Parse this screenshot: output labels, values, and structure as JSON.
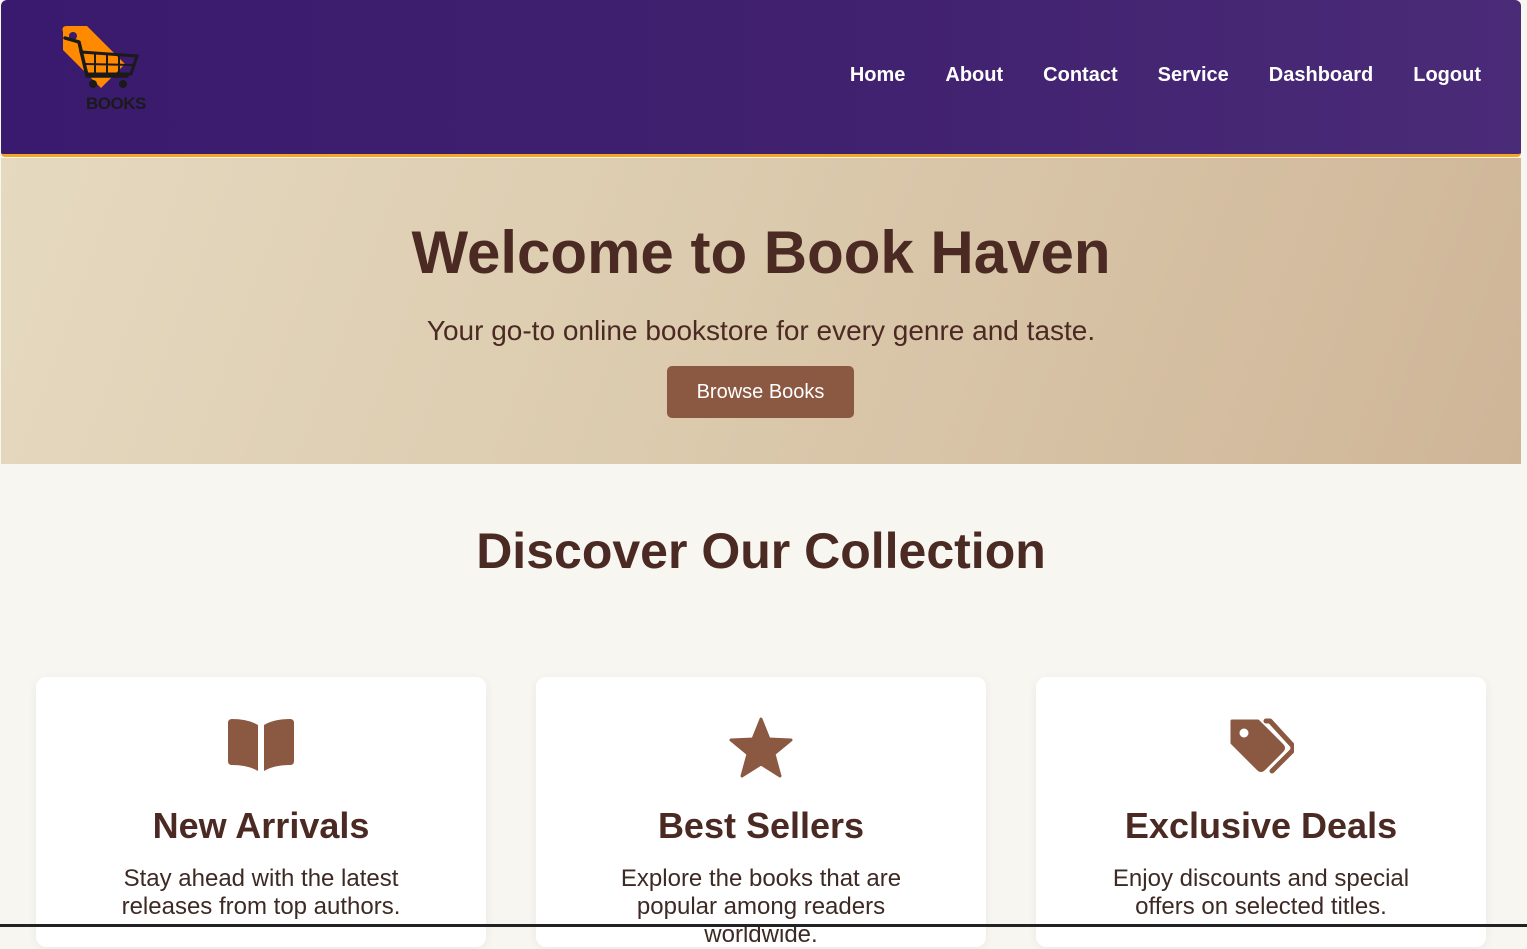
{
  "header": {
    "logo_text": "BOOKS",
    "nav": [
      {
        "label": "Home"
      },
      {
        "label": "About"
      },
      {
        "label": "Contact"
      },
      {
        "label": "Service"
      },
      {
        "label": "Dashboard"
      },
      {
        "label": "Logout"
      }
    ],
    "colors": {
      "background": "#3a1a6e",
      "accent_border": "#f5a623",
      "logo_tag": "#ff8a00"
    }
  },
  "hero": {
    "title": "Welcome to Book Haven",
    "subtitle": "Your go-to online bookstore for every genre and taste.",
    "button_label": "Browse Books",
    "colors": {
      "text": "#4a2a22",
      "button": "#8b5842"
    }
  },
  "collection": {
    "title": "Discover Our Collection",
    "cards": [
      {
        "icon": "book-open-icon",
        "title": "New Arrivals",
        "text": "Stay ahead with the latest releases from top authors."
      },
      {
        "icon": "star-icon",
        "title": "Best Sellers",
        "text": "Explore the books that are popular among readers worldwide."
      },
      {
        "icon": "tags-icon",
        "title": "Exclusive Deals",
        "text": "Enjoy discounts and special offers on selected titles."
      }
    ],
    "icon_color": "#8b5842"
  }
}
